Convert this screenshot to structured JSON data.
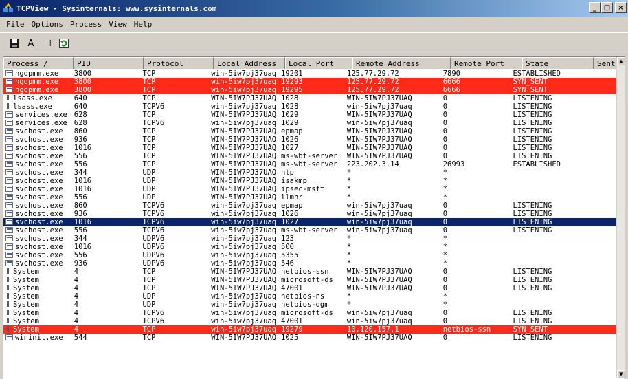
{
  "window": {
    "title": "TCPView - Sysinternals: www.sysinternals.com",
    "minimize": "_",
    "maximize": "□",
    "close": "×"
  },
  "menu": [
    "File",
    "Options",
    "Process",
    "View",
    "Help"
  ],
  "toolbar": {
    "save_icon": "save-icon",
    "font_label": "A",
    "connect_label": "⊣",
    "refresh_icon": "refresh-icon"
  },
  "columns": [
    "Process  /",
    "PID",
    "Protocol",
    "Local Address",
    "Local Port",
    "Remote Address",
    "Remote Port",
    "State",
    "Sent Pa"
  ],
  "colors": {
    "highlight_red": "#ff2a1a",
    "selected": "#0a246a"
  },
  "rows": [
    {
      "p": "hgdpmm.exe",
      "pid": "3800",
      "proto": "TCP",
      "la": "win-5iw7pj37uaq",
      "lp": "19201",
      "ra": "125.77.29.72",
      "rp": "7890",
      "st": "ESTABLISHED",
      "hl": "",
      "icon": "app"
    },
    {
      "p": "hgdpmm.exe",
      "pid": "3800",
      "proto": "TCP",
      "la": "win-5iw7pj37uaq",
      "lp": "19293",
      "ra": "125.77.29.72",
      "rp": "6666",
      "st": "SYN_SENT",
      "hl": "red",
      "icon": "app"
    },
    {
      "p": "hgdpmm.exe",
      "pid": "3800",
      "proto": "TCP",
      "la": "win-5iw7pj37uaq",
      "lp": "19295",
      "ra": "125.77.29.72",
      "rp": "6666",
      "st": "SYN_SENT",
      "hl": "red",
      "icon": "app"
    },
    {
      "p": "lsass.exe",
      "pid": "640",
      "proto": "TCP",
      "la": "WIN-5IW7PJ37UAQ",
      "lp": "1028",
      "ra": "WIN-5IW7PJ37UAQ",
      "rp": "0",
      "st": "LISTENING",
      "hl": "",
      "icon": "sys"
    },
    {
      "p": "lsass.exe",
      "pid": "640",
      "proto": "TCPV6",
      "la": "win-5iw7pj37uaq",
      "lp": "1028",
      "ra": "win-5iw7pj37uaq",
      "rp": "0",
      "st": "LISTENING",
      "hl": "",
      "icon": "sys"
    },
    {
      "p": "services.exe",
      "pid": "628",
      "proto": "TCP",
      "la": "WIN-5IW7PJ37UAQ",
      "lp": "1029",
      "ra": "WIN-5IW7PJ37UAQ",
      "rp": "0",
      "st": "LISTENING",
      "hl": "",
      "icon": "app"
    },
    {
      "p": "services.exe",
      "pid": "628",
      "proto": "TCPV6",
      "la": "win-5iw7pj37uaq",
      "lp": "1029",
      "ra": "win-5iw7pj37uaq",
      "rp": "0",
      "st": "LISTENING",
      "hl": "",
      "icon": "app"
    },
    {
      "p": "svchost.exe",
      "pid": "860",
      "proto": "TCP",
      "la": "WIN-5IW7PJ37UAQ",
      "lp": "epmap",
      "ra": "WIN-5IW7PJ37UAQ",
      "rp": "0",
      "st": "LISTENING",
      "hl": "",
      "icon": "app"
    },
    {
      "p": "svchost.exe",
      "pid": "936",
      "proto": "TCP",
      "la": "WIN-5IW7PJ37UAQ",
      "lp": "1026",
      "ra": "WIN-5IW7PJ37UAQ",
      "rp": "0",
      "st": "LISTENING",
      "hl": "",
      "icon": "app"
    },
    {
      "p": "svchost.exe",
      "pid": "1016",
      "proto": "TCP",
      "la": "WIN-5IW7PJ37UAQ",
      "lp": "1027",
      "ra": "WIN-5IW7PJ37UAQ",
      "rp": "0",
      "st": "LISTENING",
      "hl": "",
      "icon": "app"
    },
    {
      "p": "svchost.exe",
      "pid": "556",
      "proto": "TCP",
      "la": "WIN-5IW7PJ37UAQ",
      "lp": "ms-wbt-server",
      "ra": "WIN-5IW7PJ37UAQ",
      "rp": "0",
      "st": "LISTENING",
      "hl": "",
      "icon": "app"
    },
    {
      "p": "svchost.exe",
      "pid": "556",
      "proto": "TCP",
      "la": "WIN-5IW7PJ37UAQ",
      "lp": "ms-wbt-server",
      "ra": "223.202.3.14",
      "rp": "26993",
      "st": "ESTABLISHED",
      "hl": "",
      "icon": "app"
    },
    {
      "p": "svchost.exe",
      "pid": "344",
      "proto": "UDP",
      "la": "WIN-5IW7PJ37UAQ",
      "lp": "ntp",
      "ra": "*",
      "rp": "*",
      "st": "",
      "hl": "",
      "icon": "app"
    },
    {
      "p": "svchost.exe",
      "pid": "1016",
      "proto": "UDP",
      "la": "WIN-5IW7PJ37UAQ",
      "lp": "isakmp",
      "ra": "*",
      "rp": "*",
      "st": "",
      "hl": "",
      "icon": "app"
    },
    {
      "p": "svchost.exe",
      "pid": "1016",
      "proto": "UDP",
      "la": "WIN-5IW7PJ37UAQ",
      "lp": "ipsec-msft",
      "ra": "*",
      "rp": "*",
      "st": "",
      "hl": "",
      "icon": "app"
    },
    {
      "p": "svchost.exe",
      "pid": "556",
      "proto": "UDP",
      "la": "WIN-5IW7PJ37UAQ",
      "lp": "llmnr",
      "ra": "*",
      "rp": "*",
      "st": "",
      "hl": "",
      "icon": "app"
    },
    {
      "p": "svchost.exe",
      "pid": "860",
      "proto": "TCPV6",
      "la": "win-5iw7pj37uaq",
      "lp": "epmap",
      "ra": "win-5iw7pj37uaq",
      "rp": "0",
      "st": "LISTENING",
      "hl": "",
      "icon": "app"
    },
    {
      "p": "svchost.exe",
      "pid": "936",
      "proto": "TCPV6",
      "la": "win-5iw7pj37uaq",
      "lp": "1026",
      "ra": "win-5iw7pj37uaq",
      "rp": "0",
      "st": "LISTENING",
      "hl": "",
      "icon": "app"
    },
    {
      "p": "svchost.exe",
      "pid": "1016",
      "proto": "TCPV6",
      "la": "win-5iw7pj37uaq",
      "lp": "1027",
      "ra": "win-5iw7pj37uaq",
      "rp": "0",
      "st": "LISTENING",
      "hl": "sel",
      "icon": "app"
    },
    {
      "p": "svchost.exe",
      "pid": "556",
      "proto": "TCPV6",
      "la": "win-5iw7pj37uaq",
      "lp": "ms-wbt-server",
      "ra": "win-5iw7pj37uaq",
      "rp": "0",
      "st": "LISTENING",
      "hl": "",
      "icon": "app"
    },
    {
      "p": "svchost.exe",
      "pid": "344",
      "proto": "UDPV6",
      "la": "win-5iw7pj37uaq",
      "lp": "123",
      "ra": "*",
      "rp": "*",
      "st": "",
      "hl": "",
      "icon": "app"
    },
    {
      "p": "svchost.exe",
      "pid": "1016",
      "proto": "UDPV6",
      "la": "win-5iw7pj37uaq",
      "lp": "500",
      "ra": "*",
      "rp": "*",
      "st": "",
      "hl": "",
      "icon": "app"
    },
    {
      "p": "svchost.exe",
      "pid": "556",
      "proto": "UDPV6",
      "la": "win-5iw7pj37uaq",
      "lp": "5355",
      "ra": "*",
      "rp": "*",
      "st": "",
      "hl": "",
      "icon": "app"
    },
    {
      "p": "svchost.exe",
      "pid": "936",
      "proto": "UDPV6",
      "la": "win-5iw7pj37uaq",
      "lp": "546",
      "ra": "*",
      "rp": "*",
      "st": "",
      "hl": "",
      "icon": "app"
    },
    {
      "p": "System",
      "pid": "4",
      "proto": "TCP",
      "la": "WIN-5IW7PJ37UAQ",
      "lp": "netbios-ssn",
      "ra": "WIN-5IW7PJ37UAQ",
      "rp": "0",
      "st": "LISTENING",
      "hl": "",
      "icon": "sys"
    },
    {
      "p": "System",
      "pid": "4",
      "proto": "TCP",
      "la": "WIN-5IW7PJ37UAQ",
      "lp": "microsoft-ds",
      "ra": "WIN-5IW7PJ37UAQ",
      "rp": "0",
      "st": "LISTENING",
      "hl": "",
      "icon": "sys"
    },
    {
      "p": "System",
      "pid": "4",
      "proto": "TCP",
      "la": "WIN-5IW7PJ37UAQ",
      "lp": "47001",
      "ra": "WIN-5IW7PJ37UAQ",
      "rp": "0",
      "st": "LISTENING",
      "hl": "",
      "icon": "sys"
    },
    {
      "p": "System",
      "pid": "4",
      "proto": "UDP",
      "la": "win-5iw7pj37uaq",
      "lp": "netbios-ns",
      "ra": "*",
      "rp": "*",
      "st": "",
      "hl": "",
      "icon": "sys"
    },
    {
      "p": "System",
      "pid": "4",
      "proto": "UDP",
      "la": "win-5iw7pj37uaq",
      "lp": "netbios-dgm",
      "ra": "*",
      "rp": "*",
      "st": "",
      "hl": "",
      "icon": "sys"
    },
    {
      "p": "System",
      "pid": "4",
      "proto": "TCPV6",
      "la": "win-5iw7pj37uaq",
      "lp": "microsoft-ds",
      "ra": "win-5iw7pj37uaq",
      "rp": "0",
      "st": "LISTENING",
      "hl": "",
      "icon": "sys"
    },
    {
      "p": "System",
      "pid": "4",
      "proto": "TCPV6",
      "la": "win-5iw7pj37uaq",
      "lp": "47001",
      "ra": "win-5iw7pj37uaq",
      "rp": "0",
      "st": "LISTENING",
      "hl": "",
      "icon": "sys"
    },
    {
      "p": "System",
      "pid": "4",
      "proto": "TCP",
      "la": "win-5iw7pj37uaq",
      "lp": "19279",
      "ra": "10.120.157.1",
      "rp": "netbios-ssn",
      "st": "SYN_SENT",
      "hl": "red",
      "icon": "sys"
    },
    {
      "p": "wininit.exe",
      "pid": "544",
      "proto": "TCP",
      "la": "WIN-5IW7PJ37UAQ",
      "lp": "1025",
      "ra": "WIN-5IW7PJ37UAQ",
      "rp": "0",
      "st": "LISTENING",
      "hl": "",
      "icon": "app"
    }
  ]
}
